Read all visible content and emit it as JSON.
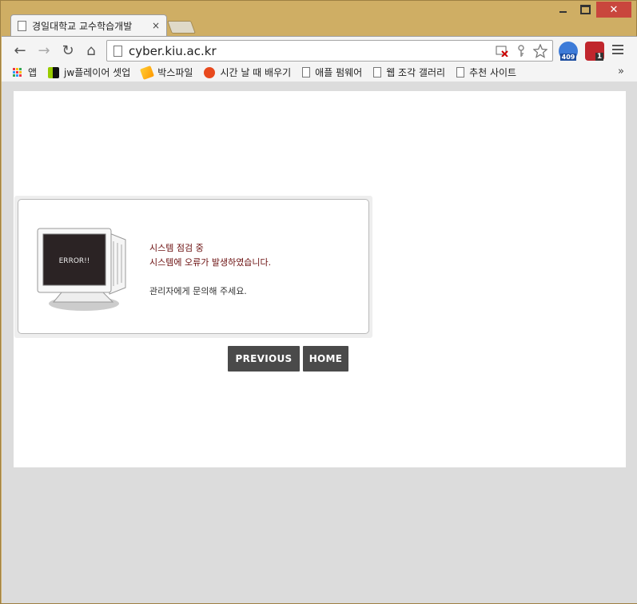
{
  "window": {
    "minimize": "",
    "maximize": "",
    "close": "✕"
  },
  "tab": {
    "title": "경일대학교 교수학습개발",
    "close": "×"
  },
  "toolbar": {
    "back": "←",
    "forward": "→",
    "reload": "↻",
    "home": "⌂",
    "url": "cyber.kiu.ac.kr",
    "ext1_badge": "409",
    "ext2_badge": "1"
  },
  "bookmarks": {
    "apps": "앱",
    "items": [
      "jw플레이어 셋업",
      "박스파일",
      "시간 날 때 배우기",
      "애플 펌웨어",
      "웹 조각 갤러리",
      "추천 사이트"
    ],
    "more": "»"
  },
  "error": {
    "monitor_text": "ERROR!!",
    "line1": "시스템 점검 중",
    "line2": "시스템에 오류가 발생하였습니다.",
    "line3": "관리자에게 문의해 주세요."
  },
  "buttons": {
    "previous": "PREVIOUS",
    "home": "HOME"
  },
  "colors": {
    "frame": "#cfae64",
    "close_button": "#c9463d",
    "error_text": "#6b0f0f",
    "button_bg": "#4a4a4a"
  }
}
